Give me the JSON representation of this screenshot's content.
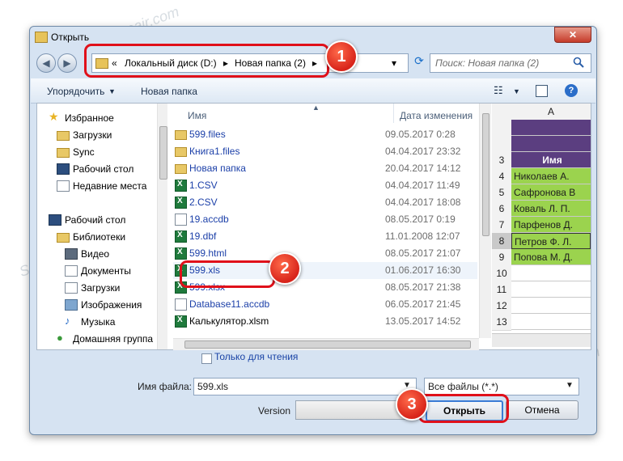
{
  "window": {
    "title": "Открыть",
    "close_label": "✕"
  },
  "address": {
    "separator_left": "«",
    "crumbs": [
      "Локальный диск (D:)",
      "Новая папка (2)"
    ],
    "arrow": "▸",
    "dropdown": "▾",
    "refresh": "⟳"
  },
  "search": {
    "placeholder": "Поиск: Новая папка (2)"
  },
  "toolbar": {
    "organize": "Упорядочить",
    "new_folder": "Новая папка"
  },
  "nav": {
    "favorites": "Избранное",
    "downloads": "Загрузки",
    "sync": "Sync",
    "desktop": "Рабочий стол",
    "recent": "Недавние места",
    "desktop2": "Рабочий стол",
    "libraries": "Библиотеки",
    "video": "Видео",
    "documents": "Документы",
    "downloads2": "Загрузки",
    "images": "Изображения",
    "music": "Музыка",
    "homegroup": "Домашняя группа"
  },
  "files": {
    "col_name": "Имя",
    "col_date": "Дата изменения",
    "rows": [
      {
        "name": "599.files",
        "date": "09.05.2017 0:28"
      },
      {
        "name": "Книга1.files",
        "date": "04.04.2017 23:32"
      },
      {
        "name": "Новая папка",
        "date": "20.04.2017 14:12"
      },
      {
        "name": "1.CSV",
        "date": "04.04.2017 11:49"
      },
      {
        "name": "2.CSV",
        "date": "04.04.2017 18:08"
      },
      {
        "name": "19.accdb",
        "date": "08.05.2017 0:19"
      },
      {
        "name": "19.dbf",
        "date": "11.01.2008 12:07"
      },
      {
        "name": "599.html",
        "date": "08.05.2017 21:07"
      },
      {
        "name": "599.xls",
        "date": "01.06.2017 16:30"
      },
      {
        "name": "599.xlsx",
        "date": "08.05.2017 21:38"
      },
      {
        "name": "Database11.accdb",
        "date": "06.05.2017 21:45"
      },
      {
        "name": "Калькулятор.xlsm",
        "date": "13.05.2017 14:52"
      }
    ]
  },
  "preview": {
    "col_header": "A",
    "rows": [
      {
        "num": "",
        "text": ""
      },
      {
        "num": "",
        "text": ""
      },
      {
        "num": "3",
        "text": "Имя"
      },
      {
        "num": "4",
        "text": "Николаев А."
      },
      {
        "num": "5",
        "text": "Сафронова В"
      },
      {
        "num": "6",
        "text": "Коваль Л. П."
      },
      {
        "num": "7",
        "text": "Парфенов Д."
      },
      {
        "num": "8",
        "text": "Петров Ф. Л."
      },
      {
        "num": "9",
        "text": "Попова М. Д."
      },
      {
        "num": "10",
        "text": ""
      },
      {
        "num": "11",
        "text": ""
      },
      {
        "num": "12",
        "text": ""
      },
      {
        "num": "13",
        "text": ""
      }
    ]
  },
  "bottom": {
    "readonly": "Только для чтения",
    "filename_label": "Имя файла:",
    "filename_value": "599.xls",
    "filetype": "Все файлы (*.*)",
    "version_label": "Version",
    "open": "Открыть",
    "cancel": "Отмена"
  },
  "badges": [
    "1",
    "2",
    "3"
  ],
  "watermark": "Soringpcrepair.com",
  "colors": {
    "accent_red": "#e0101a",
    "header_purple": "#5b3e80",
    "cell_green": "#9bd34e"
  }
}
